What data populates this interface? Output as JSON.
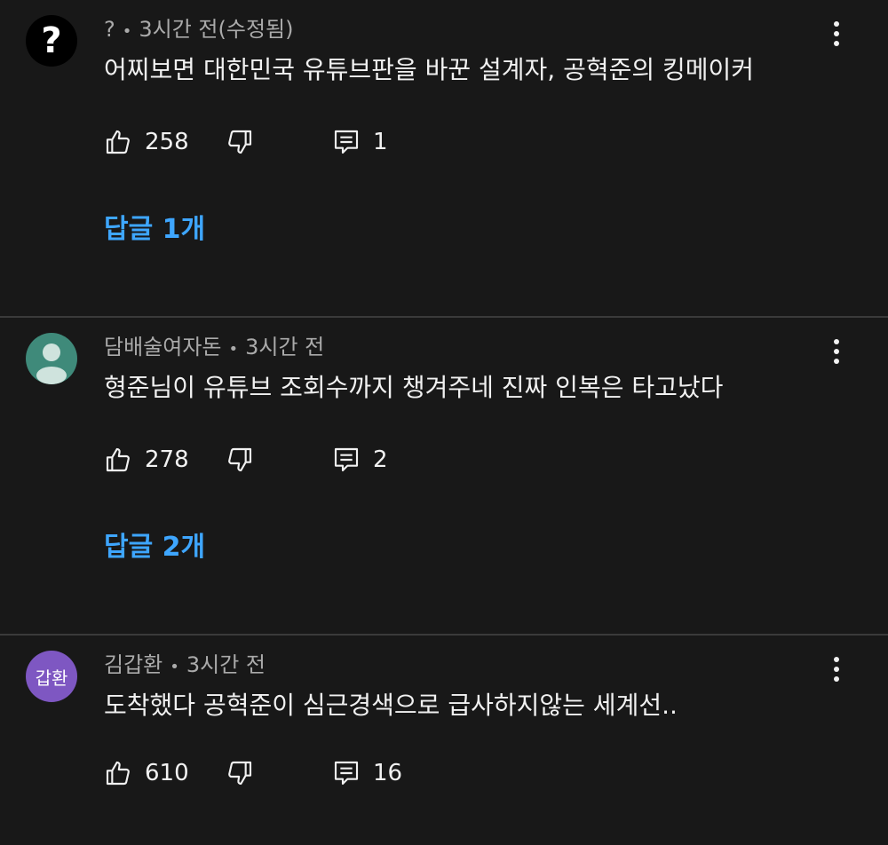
{
  "comments": [
    {
      "author": "?",
      "time": "3시간 전(수정됨)",
      "text": "어찌보면 대한민국 유튜브판을 바꾼 설계자, 공혁준의 킹메이커",
      "likes": "258",
      "replies_count": "1",
      "replies_label": "답글 1개",
      "avatar": {
        "type": "question-mark",
        "bg": "#000000",
        "fg": "#ffffff",
        "glyph": "?"
      }
    },
    {
      "author": "담배술여자돈",
      "time": "3시간 전",
      "text": "형준님이 유튜브 조회수까지 챙겨주네 진짜 인복은 타고났다",
      "likes": "278",
      "replies_count": "2",
      "replies_label": "답글 2개",
      "avatar": {
        "type": "default-person",
        "bg": "#3f8a7a",
        "fg": "#cfe3dd"
      }
    },
    {
      "author": "김갑환",
      "time": "3시간 전",
      "text": "도착했다 공혁준이 심근경색으로 급사하지않는 세계선..",
      "likes": "610",
      "replies_count": "16",
      "avatar": {
        "type": "text",
        "bg": "#7e57c2",
        "fg": "#ffffff",
        "label": "갑환"
      }
    }
  ],
  "icons": {
    "like": "thumb-up-icon",
    "dislike": "thumb-down-icon",
    "reply": "comment-icon",
    "more": "more-vert-icon"
  },
  "colors": {
    "background": "#181818",
    "link": "#3ea6ff",
    "meta": "#aaaaaa",
    "divider": "#3a3a3a"
  }
}
